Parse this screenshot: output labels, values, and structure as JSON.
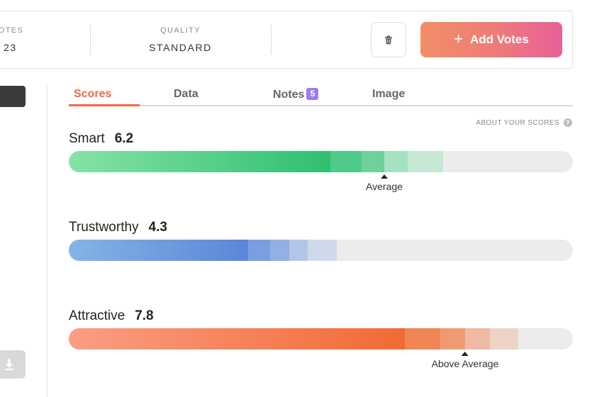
{
  "stats": {
    "votes": {
      "label": "VOTES",
      "value": "23"
    },
    "quality": {
      "label": "QUALITY",
      "value": "STANDARD"
    }
  },
  "actions": {
    "delete_icon": "trash-icon",
    "add_votes_plus": "+",
    "add_votes_label": "Add Votes"
  },
  "tabs": [
    {
      "label": "Scores",
      "active": true
    },
    {
      "label": "Data",
      "active": false
    },
    {
      "label": "Notes",
      "badge": "5",
      "active": false
    },
    {
      "label": "Image",
      "active": false
    }
  ],
  "about_scores": {
    "label": "ABOUT YOUR SCORES",
    "icon": "help-icon",
    "icon_text": "?"
  },
  "scores": [
    {
      "name": "Smart",
      "value": "6.2",
      "marker_label": "Average",
      "color": "#2fbf71"
    },
    {
      "name": "Trustworthy",
      "value": "4.3",
      "marker_label": "",
      "color": "#5b86d8"
    },
    {
      "name": "Attractive",
      "value": "7.8",
      "marker_label": "Above Average",
      "color": "#f26a33"
    }
  ],
  "colors": {
    "accent": "#ee6a43",
    "badge": "#9b7fe6",
    "track": "#ececec"
  }
}
